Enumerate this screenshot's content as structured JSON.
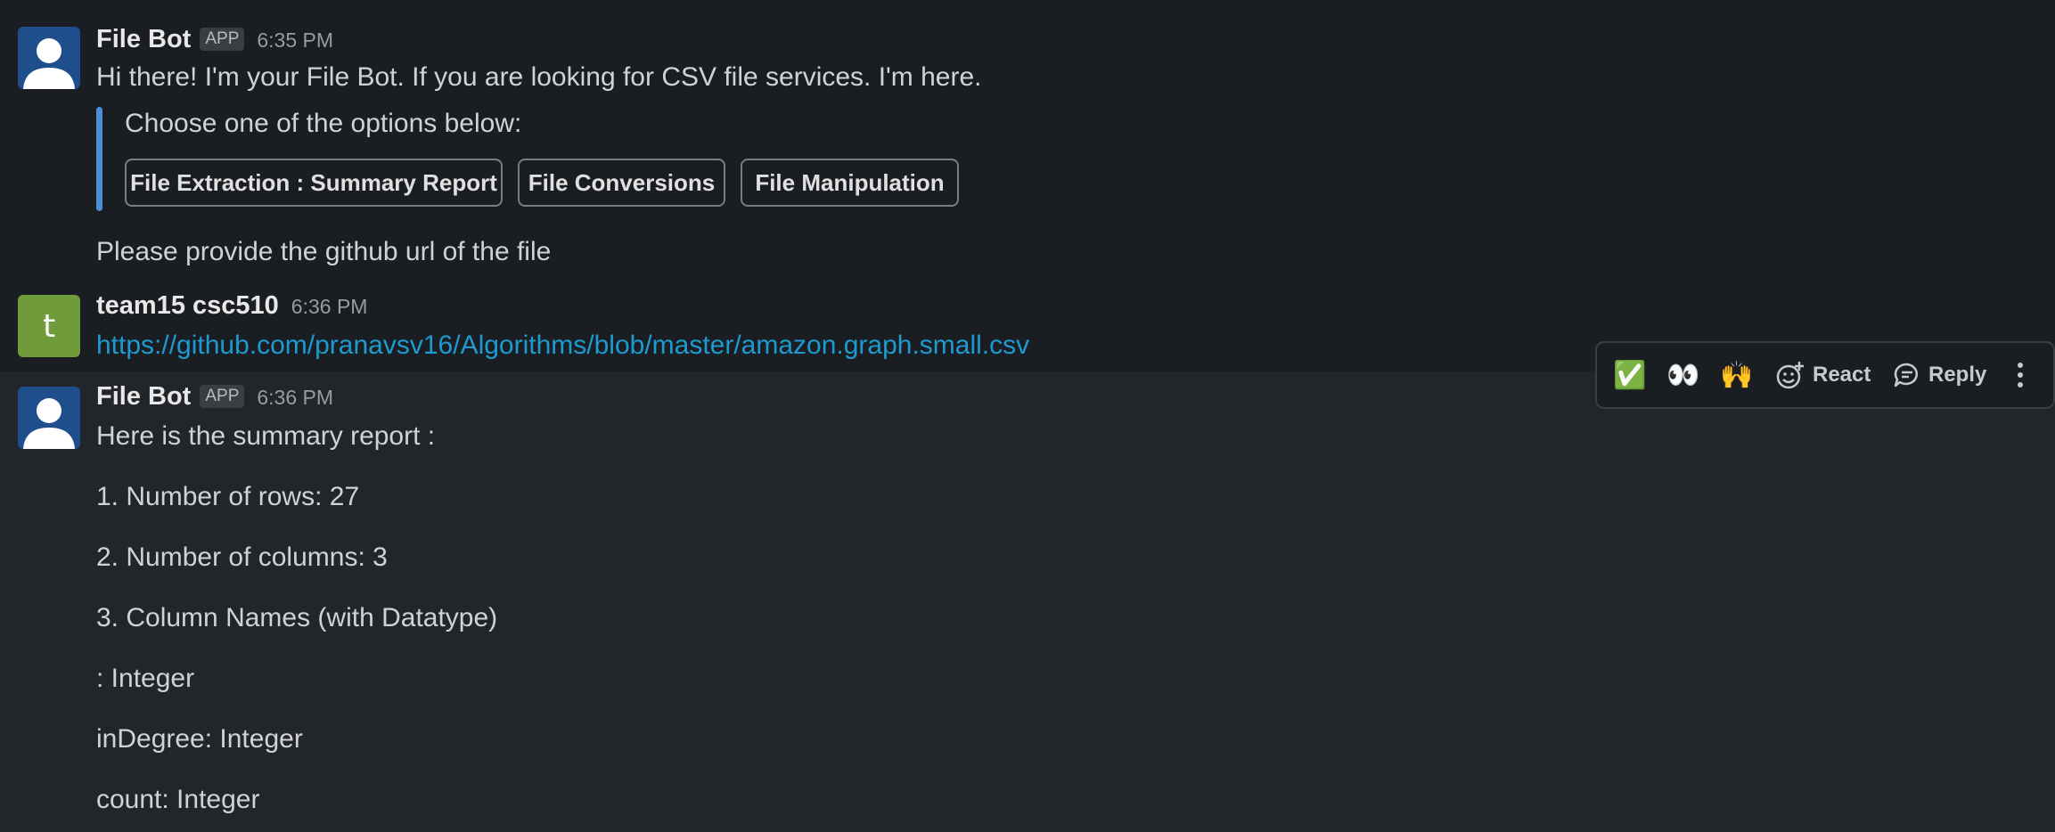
{
  "messages": [
    {
      "author": "File Bot",
      "badge": "APP",
      "time": "6:35 PM",
      "text": "Hi there! I'm your File Bot. If you are looking for CSV file services. I'm here.",
      "attachment": {
        "prompt": "Choose one of the options below:",
        "buttons": [
          "File Extraction : Summary Report",
          "File Conversions",
          "File Manipulation"
        ]
      },
      "followup": "Please provide the github url of the file"
    },
    {
      "author": "team15 csc510",
      "avatar_letter": "t",
      "time": "6:36 PM",
      "link": "https://github.com/pranavsv16/Algorithms/blob/master/amazon.graph.small.csv"
    },
    {
      "author": "File Bot",
      "badge": "APP",
      "time": "6:36 PM",
      "lines": [
        "Here is the summary report :",
        "1. Number of rows: 27",
        "2. Number of columns: 3",
        "3. Column Names (with Datatype)",
        ": Integer",
        "inDegree: Integer",
        "count: Integer"
      ]
    }
  ],
  "toolbar": {
    "emoji": [
      "✅",
      "👀",
      "🙌"
    ],
    "react_label": "React",
    "reply_label": "Reply",
    "icons": [
      "add-reaction-icon",
      "reply-icon",
      "more-actions-icon"
    ]
  },
  "colors": {
    "background": "#1a1d21",
    "hover_background": "#222529",
    "link": "#1d9bd1",
    "attachment_bar": "#4a90d9"
  }
}
